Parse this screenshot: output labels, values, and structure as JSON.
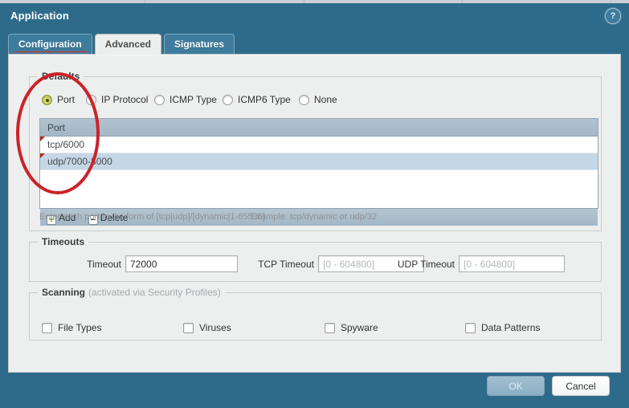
{
  "dialog": {
    "title": "Application",
    "help_icon": "help-icon",
    "help_glyph": "?"
  },
  "tabs": [
    {
      "label": "Configuration",
      "active": false,
      "misspelled": true
    },
    {
      "label": "Advanced",
      "active": true,
      "misspelled": false
    },
    {
      "label": "Signatures",
      "active": false,
      "misspelled": false
    }
  ],
  "defaults": {
    "legend": "Defaults",
    "radios": [
      {
        "label": "Port",
        "checked": true
      },
      {
        "label": "IP Protocol",
        "checked": false
      },
      {
        "label": "ICMP Type",
        "checked": false
      },
      {
        "label": "ICMP6 Type",
        "checked": false
      },
      {
        "label": "None",
        "checked": false
      }
    ],
    "table": {
      "column_header": "Port",
      "rows": [
        {
          "value": "tcp/6000",
          "flagged": true
        },
        {
          "value": "udp/7000-8000",
          "flagged": true
        }
      ],
      "add_label": "Add",
      "add_glyph": "+",
      "delete_label": "Delete",
      "delete_glyph": "−"
    },
    "hint_text": "Enter each port in the form of [tcp|udp]/[dynamic|1-65535]",
    "hint_example": "Example: tcp/dynamic or udp/32"
  },
  "timeouts": {
    "legend": "Timeouts",
    "fields": [
      {
        "label": "Timeout",
        "value": "72000",
        "placeholder": ""
      },
      {
        "label": "TCP Timeout",
        "value": "",
        "placeholder": "[0 - 604800]"
      },
      {
        "label": "UDP Timeout",
        "value": "",
        "placeholder": "[0 - 604800]"
      }
    ]
  },
  "scanning": {
    "legend": "Scanning",
    "legend_sub": "(activated via Security Profiles)",
    "checkboxes": [
      {
        "label": "File Types",
        "checked": false
      },
      {
        "label": "Viruses",
        "checked": false
      },
      {
        "label": "Spyware",
        "checked": false
      },
      {
        "label": "Data Patterns",
        "checked": false
      }
    ]
  },
  "footer": {
    "ok_label": "OK",
    "ok_disabled": true,
    "cancel_label": "Cancel"
  },
  "annotation": {
    "shape": "ellipse",
    "color": "#cc2229"
  },
  "colors": {
    "dialog_chrome": "#2e6b8a",
    "panel": "#edeeee",
    "tab_inactive": "#3d7c9c",
    "table_header": "#a8bcca",
    "row_selected": "#c5d7e6",
    "annotation_red": "#cc2229",
    "radio_checked": "#c2ca55"
  }
}
